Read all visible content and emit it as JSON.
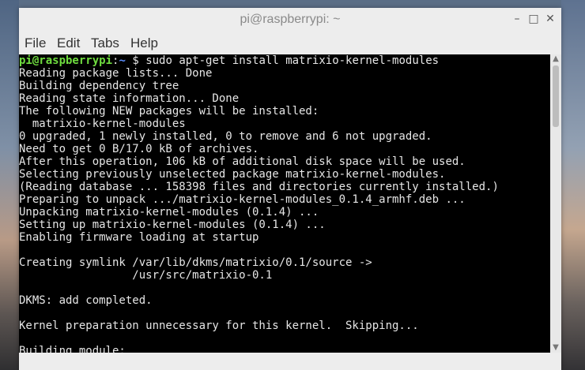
{
  "window": {
    "title": "pi@raspberrypi: ~"
  },
  "menu": {
    "file": "File",
    "edit": "Edit",
    "tabs": "Tabs",
    "help": "Help"
  },
  "terminal": {
    "prompt_user": "pi@raspberrypi",
    "prompt_sep": ":",
    "prompt_path": "~",
    "prompt_symbol": " $ ",
    "command": "sudo apt-get install matrixio-kernel-modules",
    "lines": [
      "Reading package lists... Done",
      "Building dependency tree",
      "Reading state information... Done",
      "The following NEW packages will be installed:",
      "  matrixio-kernel-modules",
      "0 upgraded, 1 newly installed, 0 to remove and 6 not upgraded.",
      "Need to get 0 B/17.0 kB of archives.",
      "After this operation, 106 kB of additional disk space will be used.",
      "Selecting previously unselected package matrixio-kernel-modules.",
      "(Reading database ... 158398 files and directories currently installed.)",
      "Preparing to unpack .../matrixio-kernel-modules_0.1.4_armhf.deb ...",
      "Unpacking matrixio-kernel-modules (0.1.4) ...",
      "Setting up matrixio-kernel-modules (0.1.4) ...",
      "Enabling firmware loading at startup",
      "",
      "Creating symlink /var/lib/dkms/matrixio/0.1/source ->",
      "                 /usr/src/matrixio-0.1",
      "",
      "DKMS: add completed.",
      "",
      "Kernel preparation unnecessary for this kernel.  Skipping...",
      "",
      "Building module:"
    ]
  },
  "controls": {
    "minimize_icon": "minimize-icon",
    "maximize_icon": "maximize-icon",
    "close_icon": "close-icon"
  },
  "colors": {
    "terminal_bg": "#000000",
    "terminal_fg": "#e6e6e6",
    "prompt_user": "#6fdc3f",
    "prompt_path": "#5c8fff",
    "window_chrome": "#ededed"
  }
}
